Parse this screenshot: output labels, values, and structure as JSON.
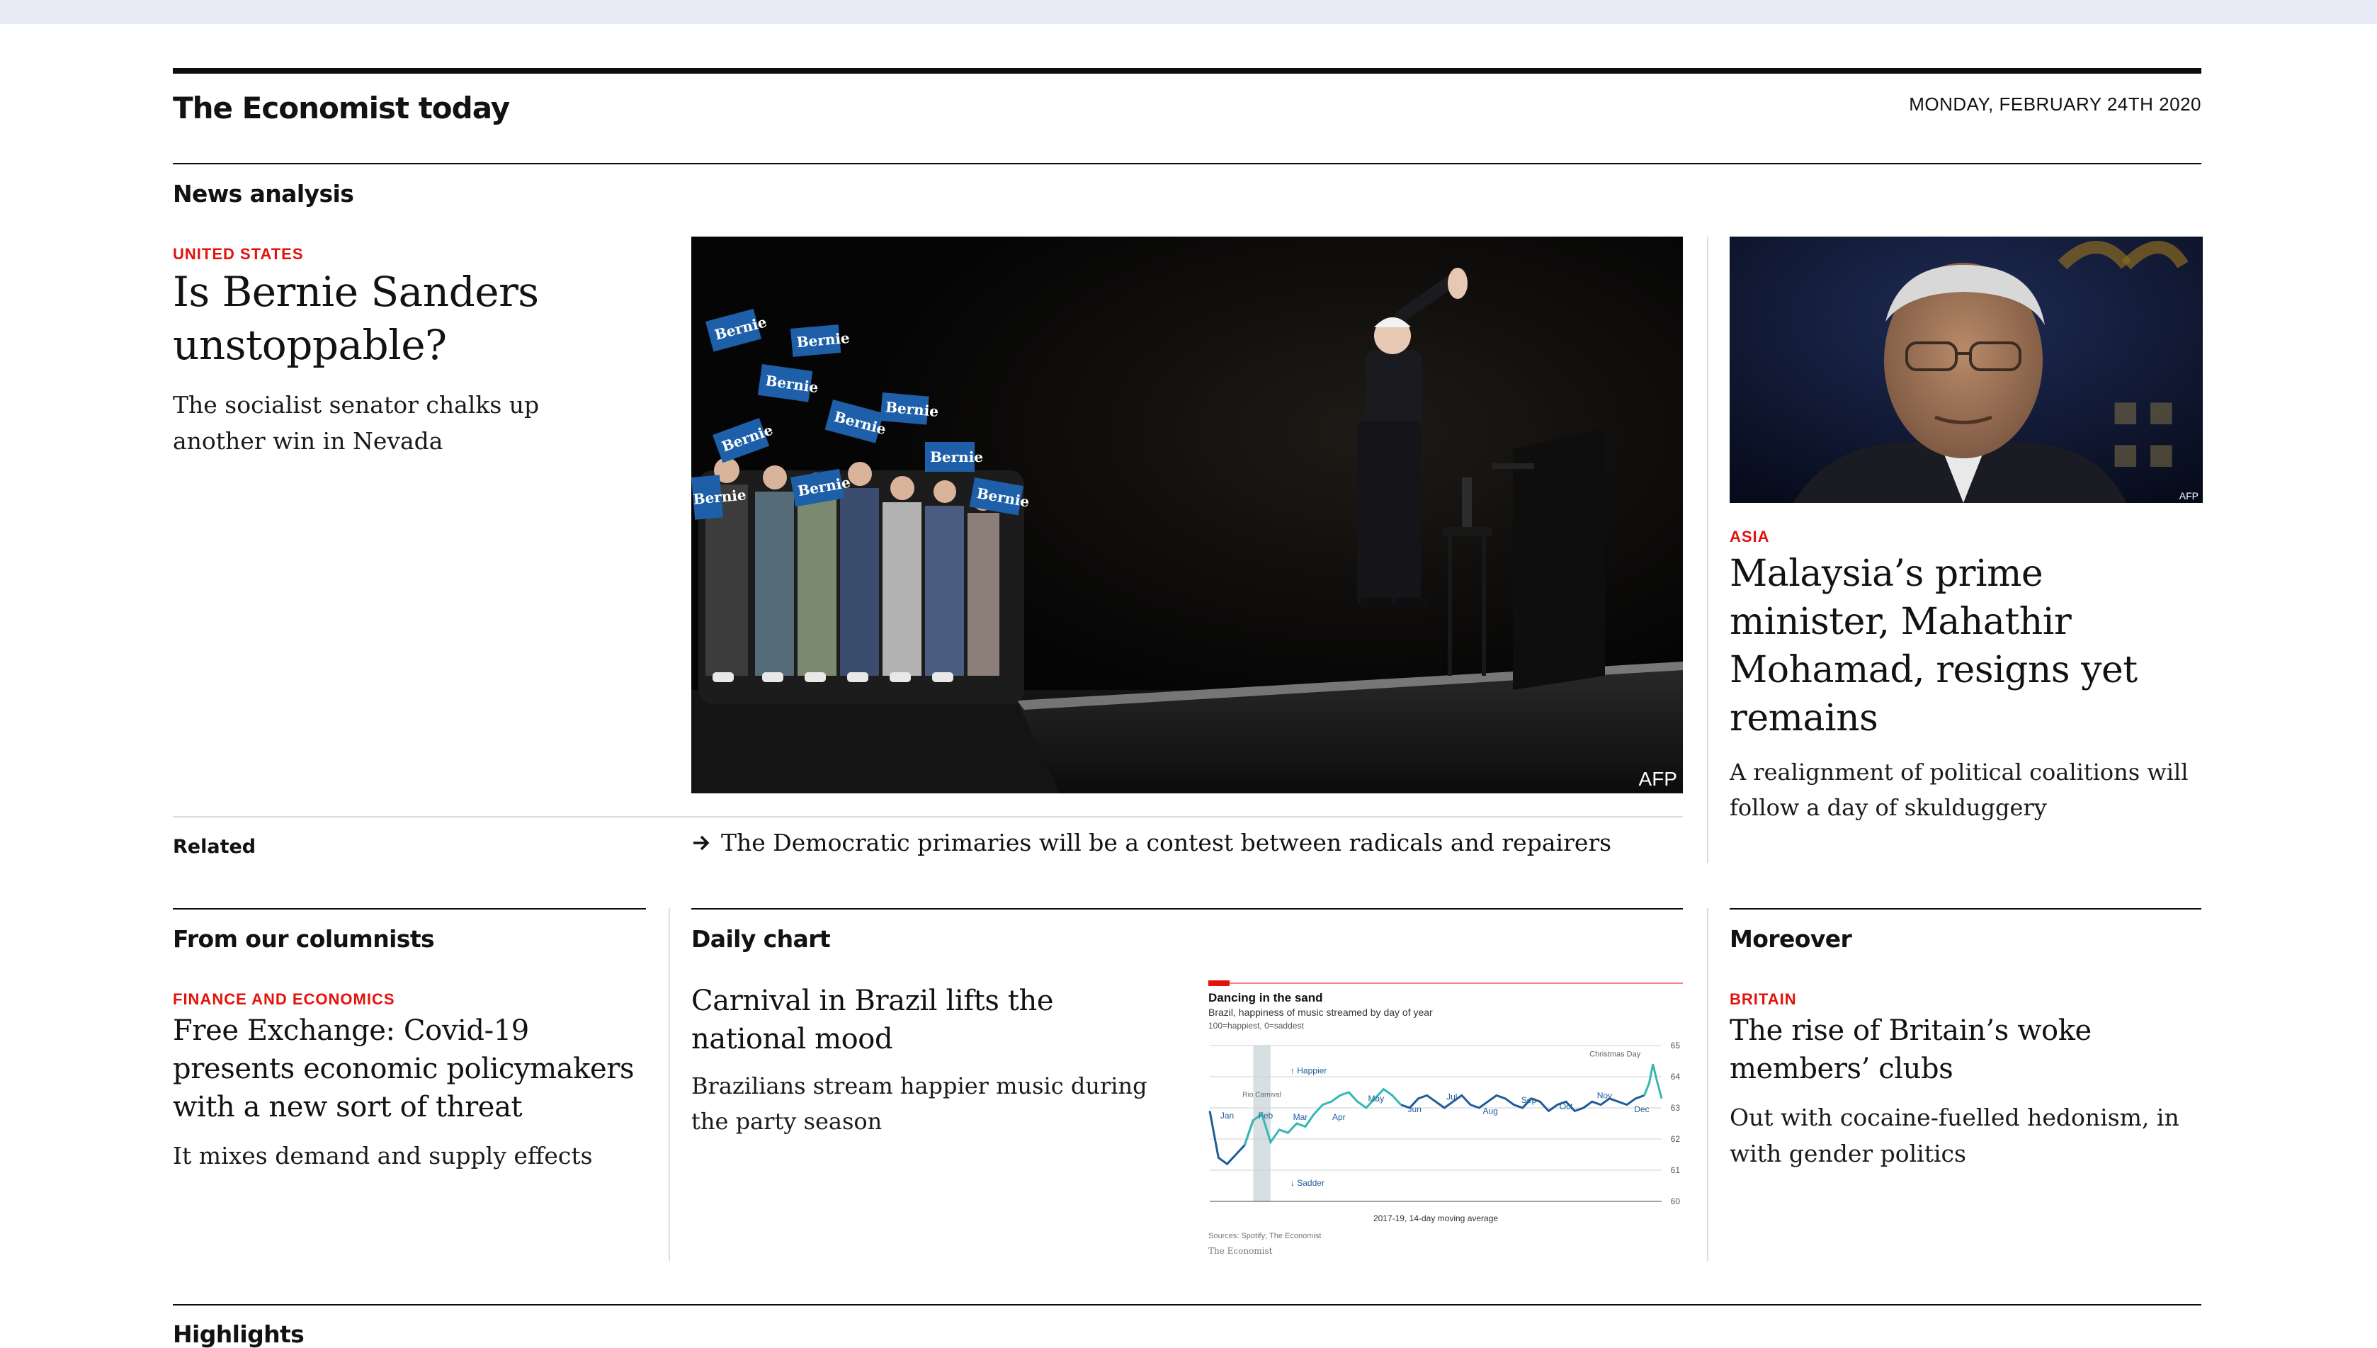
{
  "header": {
    "brand": "The Economist today",
    "date": "MONDAY, FEBRUARY 24TH 2020"
  },
  "news_analysis": {
    "section_title": "News analysis",
    "lead": {
      "kicker": "UNITED STATES",
      "title": "Is Bernie Sanders unstoppable?",
      "description": "The socialist senator chalks up another win in Nevada",
      "image_credit": "AFP",
      "signs": [
        "Bernie",
        "Bernie",
        "Bernie",
        "Bernie",
        "Bernie",
        "Bernie",
        "Bernie",
        "Bernie",
        "Bernie",
        "Bernie"
      ]
    },
    "related_label": "Related",
    "related_link": "The Democratic primaries will be a contest between radicals and repairers",
    "side": {
      "kicker": "ASIA",
      "title": "Malaysia’s prime minister, Mahathir Mohamad, resigns yet remains",
      "description": "A realignment of political coalitions will follow a day of skulduggery",
      "image_credit": "AFP"
    }
  },
  "columnists": {
    "section_title": "From our columnists",
    "kicker": "FINANCE AND ECONOMICS",
    "title": "Free Exchange: Covid-19 presents economic policymakers with a new sort of threat",
    "description": "It mixes demand and supply effects"
  },
  "daily_chart": {
    "section_title": "Daily chart",
    "title": "Carnival in Brazil lifts the national mood",
    "description": "Brazilians stream happier music during the party season"
  },
  "moreover": {
    "section_title": "Moreover",
    "kicker": "BRITAIN",
    "title": "The rise of Britain’s woke members’ clubs",
    "description": "Out with cocaine-fuelled hedonism, in with gender politics"
  },
  "highlights": {
    "section_title": "Highlights"
  },
  "chart_data": {
    "type": "line",
    "title": "Dancing in the sand",
    "subtitle": "Brazil, happiness of music streamed by day of year",
    "subtitle2": "100=happiest, 0=saddest",
    "legend": "2017-19, 14-day moving average",
    "source": "Sources: Spotify; The Economist",
    "brand": "The Economist",
    "ylim": [
      60,
      65
    ],
    "yticks": [
      65,
      64,
      63,
      62,
      61,
      60
    ],
    "months": [
      "Jan",
      "Feb",
      "Mar",
      "Apr",
      "May",
      "Jun",
      "Jul",
      "Aug",
      "Sep",
      "Oct",
      "Nov",
      "Dec"
    ],
    "annotations": {
      "happier": "↑ Happier",
      "sadder": "↓ Sadder",
      "carnival": "Rio Carnival",
      "christmas": "Christmas Day"
    },
    "x": [
      1,
      8,
      15,
      22,
      29,
      36,
      43,
      50,
      57,
      64,
      71,
      78,
      85,
      92,
      99,
      106,
      113,
      120,
      127,
      134,
      141,
      148,
      155,
      162,
      169,
      176,
      183,
      190,
      197,
      204,
      211,
      218,
      225,
      232,
      239,
      246,
      253,
      260,
      267,
      274,
      281,
      288,
      295,
      302,
      309,
      316,
      323,
      330,
      337,
      344,
      351,
      355,
      358,
      361,
      365
    ],
    "values": [
      62.9,
      61.4,
      61.2,
      61.5,
      61.8,
      62.6,
      62.8,
      61.9,
      62.3,
      62.2,
      62.5,
      62.4,
      62.8,
      63.1,
      63.2,
      63.4,
      63.5,
      63.2,
      63.0,
      63.3,
      63.6,
      63.4,
      63.1,
      63.0,
      63.3,
      63.4,
      63.2,
      63.0,
      63.2,
      63.4,
      63.1,
      63.0,
      63.2,
      63.4,
      63.3,
      63.1,
      63.0,
      63.3,
      63.2,
      62.9,
      63.1,
      63.2,
      62.9,
      63.0,
      63.2,
      63.1,
      63.3,
      63.2,
      63.1,
      63.3,
      63.4,
      63.8,
      64.4,
      63.9,
      63.3
    ]
  }
}
